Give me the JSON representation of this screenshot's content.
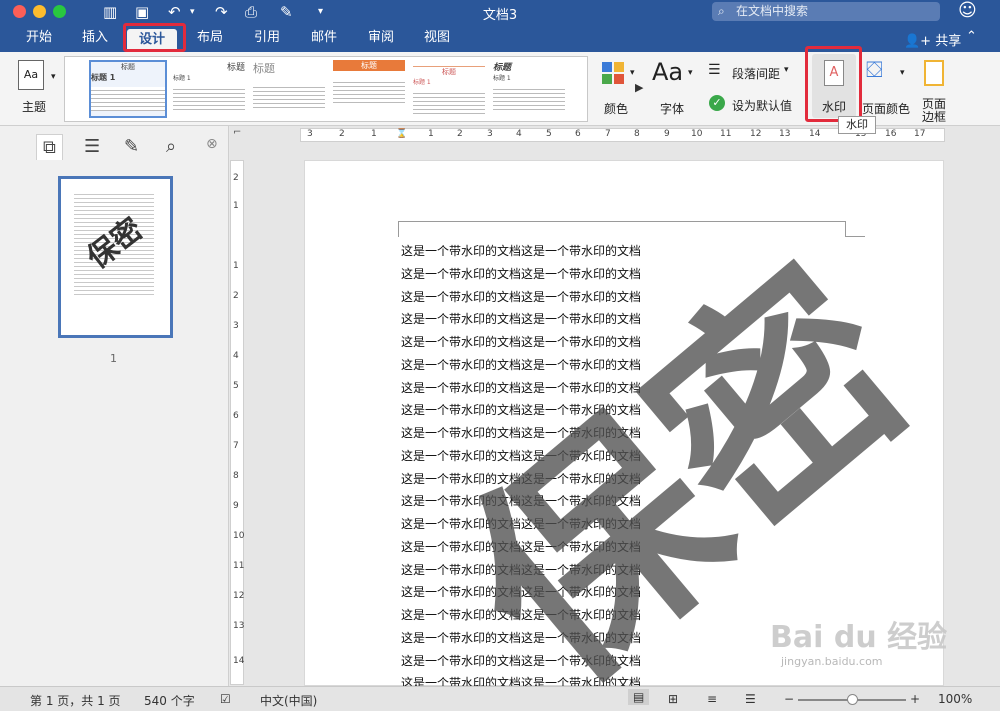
{
  "window": {
    "title": "文档3",
    "search_placeholder": "在文档中搜索"
  },
  "tabs": [
    "开始",
    "插入",
    "设计",
    "布局",
    "引用",
    "邮件",
    "审阅",
    "视图"
  ],
  "active_tab": "设计",
  "share_label": "共享",
  "ribbon": {
    "theme_label": "主题",
    "gallery": [
      {
        "head": "标题",
        "sub": "标题 1"
      },
      {
        "head": "标题",
        "sub": "标题 1"
      },
      {
        "head": "标题",
        "sub": ""
      },
      {
        "head": "标题",
        "sub": ""
      },
      {
        "head": "标题",
        "sub": "标题 1"
      },
      {
        "head": "标题",
        "sub": "标题 1"
      }
    ],
    "colors_label": "颜色",
    "fonts_label": "字体",
    "paragraph_spacing_label": "段落间距",
    "set_default_label": "设为默认值",
    "watermark_label": "水印",
    "page_color_label": "页面颜色",
    "page_borders_label": "页面\n边框"
  },
  "tooltip": "水印",
  "thumbnail": {
    "page_number": "1",
    "watermark": "保密"
  },
  "document": {
    "watermark_text": "保密",
    "lines": [
      "这是一个带水印的文档这是一个带水印的文档",
      "这是一个带水印的文档这是一个带水印的文档",
      "这是一个带水印的文档这是一个带水印的文档",
      "这是一个带水印的文档这是一个带水印的文档",
      "这是一个带水印的文档这是一个带水印的文档",
      "这是一个带水印的文档这是一个带水印的文档",
      "这是一个带水印的文档这是一个带水印的文档",
      "这是一个带水印的文档这是一个带水印的文档",
      "这是一个带水印的文档这是一个带水印的文档",
      "这是一个带水印的文档这是一个带水印的文档",
      "这是一个带水印的文档这是一个带水印的文档",
      "这是一个带水印的文档这是一个带水印的文档",
      "这是一个带水印的文档这是一个带水印的文档",
      "这是一个带水印的文档这是一个带水印的文档",
      "这是一个带水印的文档这是一个带水印的文档",
      "这是一个带水印的文档这是一个带水印的文档",
      "这是一个带水印的文档这是一个带水印的文档",
      "这是一个带水印的文档这是一个带水印的文档",
      "这是一个带水印的文档这是一个带水印的文档",
      "这是一个带水印的文档这是一个带水印的文档"
    ]
  },
  "ruler": {
    "horizontal": [
      "3",
      "2",
      "1",
      "1",
      "2",
      "3",
      "4",
      "5",
      "6",
      "7",
      "8",
      "9",
      "10",
      "11",
      "12",
      "13",
      "14",
      "15",
      "16",
      "17"
    ],
    "vertical": [
      "2",
      "1",
      "1",
      "2",
      "3",
      "4",
      "5",
      "6",
      "7",
      "8",
      "9",
      "10",
      "11",
      "12",
      "13",
      "14"
    ]
  },
  "status": {
    "page": "第 1 页，共 1 页",
    "words": "540 个字",
    "language": "中文(中国)",
    "zoom": "100%",
    "zoom_minus": "−",
    "zoom_plus": "+"
  },
  "site_watermark": {
    "brand": "Bai du 经验",
    "url": "jingyan.baidu.com"
  }
}
